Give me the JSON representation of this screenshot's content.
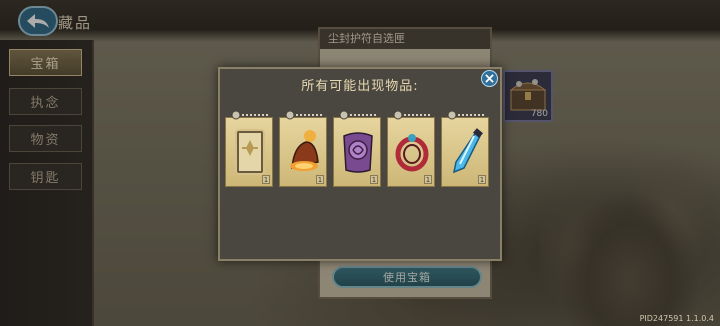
{
  "header": {
    "title": "藏品"
  },
  "sidebar": {
    "items": [
      {
        "label": "宝箱",
        "active": true
      },
      {
        "label": "执念",
        "active": false
      },
      {
        "label": "物资",
        "active": false
      },
      {
        "label": "钥匙",
        "active": false
      }
    ]
  },
  "selection_panel": {
    "title": "尘封护符自选匣",
    "use_button": "使用宝箱"
  },
  "chest": {
    "count": "780"
  },
  "version": "PID247591 1.1.0.4",
  "modal": {
    "title": "所有可能出现物品:",
    "items": [
      {
        "name": "card-item",
        "qty": "1"
      },
      {
        "name": "bell-item",
        "qty": "1"
      },
      {
        "name": "scroll-item",
        "qty": "1"
      },
      {
        "name": "amulet-item",
        "qty": "1"
      },
      {
        "name": "dagger-item",
        "qty": "1"
      }
    ]
  },
  "colors": {
    "accent_blue": "#2e6a8a",
    "card_gold": "#d9c488",
    "panel_dark": "#4a4740"
  }
}
